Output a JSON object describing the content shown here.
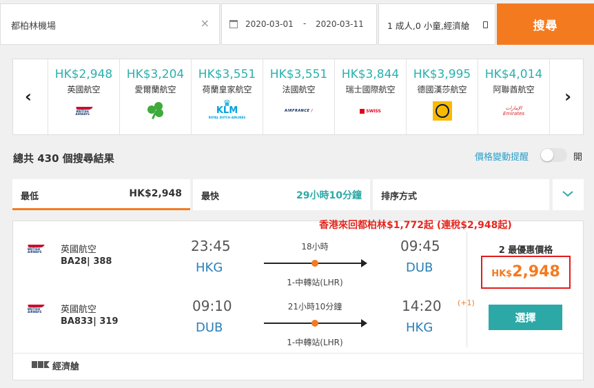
{
  "search": {
    "destination": "都柏林機場",
    "clear_icon": "×",
    "date_from": "2020-03-01",
    "date_sep": "-",
    "date_to": "2020-03-11",
    "passengers": "1 成人,0 小童,經濟艙",
    "search_label": "搜尋"
  },
  "carousel": {
    "prev": "‹",
    "next": "›",
    "airlines": [
      {
        "price": "HK$2,948",
        "name": "英國航空",
        "logo": "british-airways-logo"
      },
      {
        "price": "HK$3,204",
        "name": "愛爾蘭航空",
        "logo": "aer-lingus-shamrock-logo"
      },
      {
        "price": "HK$3,551",
        "name": "荷蘭皇家航空",
        "logo": "klm-logo"
      },
      {
        "price": "HK$3,551",
        "name": "法國航空",
        "logo": "air-france-logo"
      },
      {
        "price": "HK$3,844",
        "name": "瑞士國際航空",
        "logo": "swiss-logo"
      },
      {
        "price": "HK$3,995",
        "name": "德國漢莎航空",
        "logo": "lufthansa-logo"
      },
      {
        "price": "HK$4,014",
        "name": "阿聯酋航空",
        "logo": "emirates-logo"
      }
    ]
  },
  "results": {
    "total": "總共 430 個搜尋結果",
    "alert_label": "價格變動提醒",
    "toggle_label": "開",
    "toggle_on": false
  },
  "tabs": {
    "cheapest_label": "最低",
    "cheapest_value": "HK$2,948",
    "fastest_label": "最快",
    "fastest_value": "29小時10分鐘",
    "sort_label": "排序方式"
  },
  "promo": "香港來回都柏林$1,772起 (連稅$2,948起)",
  "flight": {
    "outbound": {
      "airline": "英國航空",
      "flight_no": "BA28| 388",
      "dep_time": "23:45",
      "dep_airport": "HKG",
      "duration": "18小時",
      "stops": "1-中轉站(LHR)",
      "arr_time": "09:45",
      "arr_airport": "DUB"
    },
    "inbound": {
      "airline": "英國航空",
      "flight_no": "BA833| 319",
      "dep_time": "09:10",
      "dep_airport": "DUB",
      "duration": "21小時10分鐘",
      "stops": "1-中轉站(LHR)",
      "arr_time": "14:20",
      "arr_airport": "HKG",
      "day_offset": "(+1)"
    },
    "best_price_label": "2 最優惠價格",
    "price_currency": "HK$",
    "price_amount": "2,948",
    "select_label": "選擇",
    "cabin": "經濟艙"
  },
  "colors": {
    "accent_orange": "#f47a20",
    "teal": "#2ca9a6",
    "promo_red": "#e5271f"
  }
}
